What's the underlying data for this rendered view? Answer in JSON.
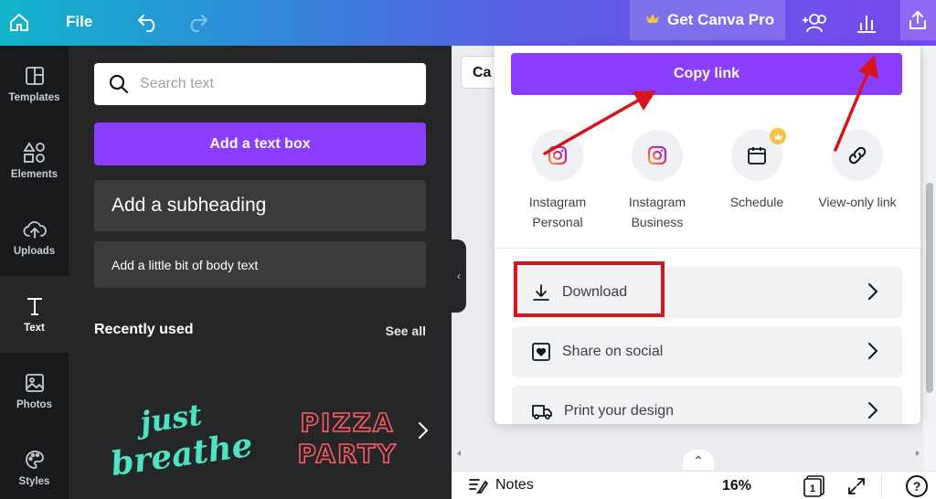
{
  "topbar": {
    "file_label": "File",
    "pro_label": "Get Canva Pro",
    "icons": [
      "home-icon",
      "undo-icon",
      "redo-icon",
      "crown-icon",
      "add-people-icon",
      "insights-icon",
      "share-icon"
    ]
  },
  "rail": {
    "items": [
      {
        "label": "Templates",
        "icon": "templates-icon"
      },
      {
        "label": "Elements",
        "icon": "elements-icon"
      },
      {
        "label": "Uploads",
        "icon": "uploads-icon"
      },
      {
        "label": "Text",
        "icon": "text-icon"
      },
      {
        "label": "Photos",
        "icon": "photos-icon"
      },
      {
        "label": "Styles",
        "icon": "styles-icon"
      }
    ]
  },
  "panel": {
    "search_placeholder": "Search text",
    "add_textbox": "Add a text box",
    "add_subheading": "Add a subheading",
    "add_body": "Add a little bit of body text",
    "recent_title": "Recently used",
    "see_all": "See all",
    "fonts": [
      {
        "line1": "just",
        "line2": "breathe"
      },
      {
        "line1": "PIZZA",
        "line2": "PARTY"
      }
    ]
  },
  "canvas": {
    "chip_text": "Ca"
  },
  "bottombar": {
    "notes_label": "Notes",
    "zoom": "16%",
    "page": "1",
    "help": "?"
  },
  "share": {
    "copy_link": "Copy link",
    "options": [
      {
        "label": "Instagram\nPersonal",
        "icon": "instagram-icon"
      },
      {
        "label": "Instagram\nBusiness",
        "icon": "instagram-icon"
      },
      {
        "label": "Schedule",
        "icon": "calendar-icon"
      },
      {
        "label": "View-only link",
        "icon": "link-icon"
      }
    ],
    "actions": [
      {
        "label": "Download",
        "icon": "download-icon"
      },
      {
        "label": "Share on social",
        "icon": "heart-icon"
      },
      {
        "label": "Print your design",
        "icon": "truck-icon"
      }
    ]
  },
  "colors": {
    "accent": "#8b3dff",
    "annotation": "#d5161c",
    "panel_bg": "#252627",
    "rail_bg": "#18191b"
  }
}
